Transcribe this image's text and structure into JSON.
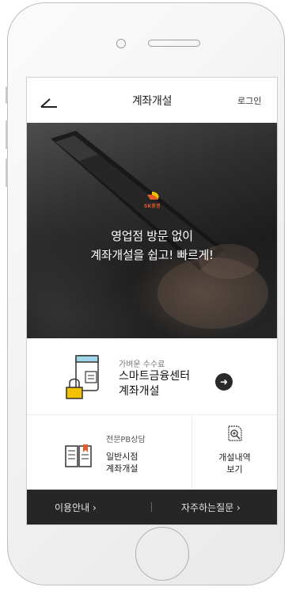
{
  "header": {
    "title": "계좌개설",
    "login_label": "로그인"
  },
  "hero": {
    "brand_text": "SK증권",
    "line1": "영업점 방문 없이",
    "line2": "계좌개설을 쉽고! 빠르게!"
  },
  "smart_center": {
    "sub_label": "가벼운 수수료",
    "title_line1": "스마트금융센터",
    "title_line2": "계좌개설",
    "arrow_icon": "arrow-right-icon"
  },
  "pb_consult": {
    "sub_label": "전문PB상담",
    "line1": "일반시점",
    "line2": "계좌개설"
  },
  "history": {
    "line1": "개설내역",
    "line2": "보기",
    "icon": "search-document-icon"
  },
  "footer": {
    "guide_label": "이용안내 ›",
    "faq_label": "자주하는질문 ›"
  },
  "colors": {
    "brand_red": "#e35b2b",
    "footer_bg": "#262626",
    "accent_yellow": "#f2c200"
  }
}
